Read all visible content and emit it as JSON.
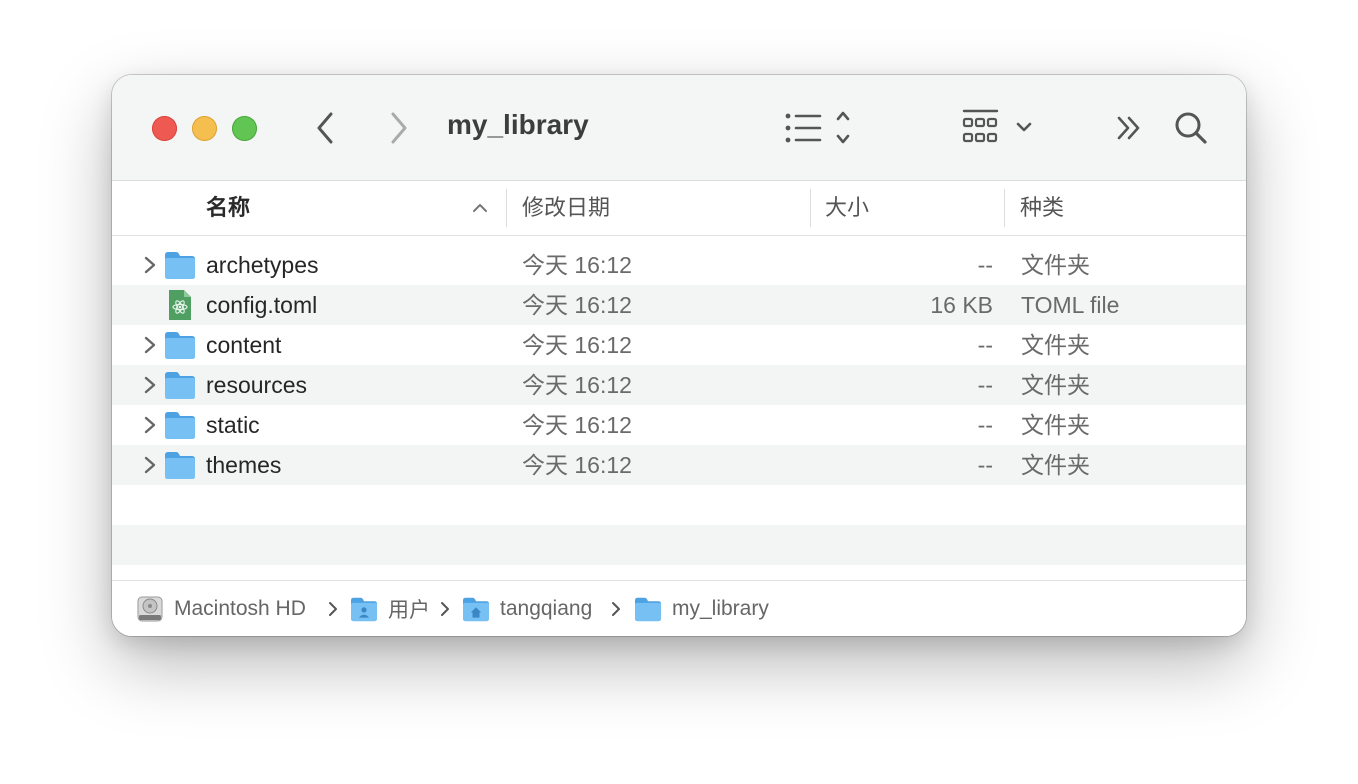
{
  "window": {
    "title": "my_library"
  },
  "toolbar": {
    "back_icon": "chevron-left-icon",
    "forward_icon": "chevron-right-icon",
    "view_icon": "list-view-icon",
    "group_icon": "group-grid-icon",
    "more_icon": "double-chevron-right-icon",
    "search_icon": "search-icon"
  },
  "columns": {
    "name": "名称",
    "date": "修改日期",
    "size": "大小",
    "kind": "种类"
  },
  "files": [
    {
      "name": "archetypes",
      "date": "今天 16:12",
      "size": "--",
      "kind": "文件夹",
      "type": "folder"
    },
    {
      "name": "config.toml",
      "date": "今天 16:12",
      "size": "16 KB",
      "kind": "TOML file",
      "type": "file"
    },
    {
      "name": "content",
      "date": "今天 16:12",
      "size": "--",
      "kind": "文件夹",
      "type": "folder"
    },
    {
      "name": "resources",
      "date": "今天 16:12",
      "size": "--",
      "kind": "文件夹",
      "type": "folder"
    },
    {
      "name": "static",
      "date": "今天 16:12",
      "size": "--",
      "kind": "文件夹",
      "type": "folder"
    },
    {
      "name": "themes",
      "date": "今天 16:12",
      "size": "--",
      "kind": "文件夹",
      "type": "folder"
    }
  ],
  "path": [
    {
      "label": "Macintosh HD",
      "icon": "hard-drive-icon"
    },
    {
      "label": "用户",
      "icon": "users-folder-icon"
    },
    {
      "label": "tangqiang",
      "icon": "home-folder-icon"
    },
    {
      "label": "my_library",
      "icon": "folder-icon"
    }
  ],
  "colors": {
    "close": "#ee5a52",
    "minimize": "#f5bf4f",
    "maximize": "#61c554",
    "folder": "#6bb8f0"
  }
}
